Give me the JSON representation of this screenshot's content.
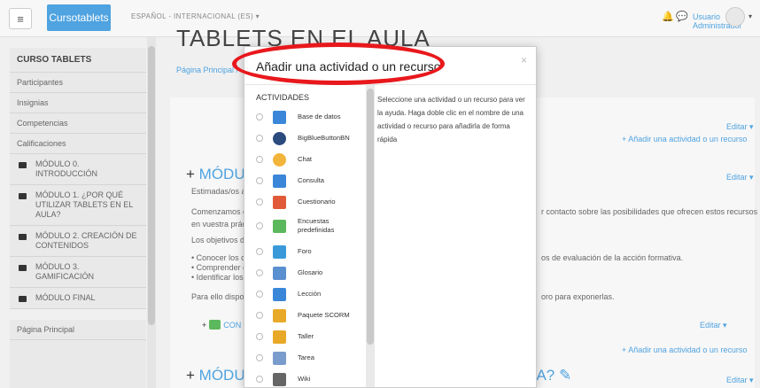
{
  "topbar": {
    "brand": "Cursotablets",
    "language": "ESPAÑOL - INTERNACIONAL (ES) ▾",
    "user_name": "Usuario Administrador",
    "menu_glyph": "≡",
    "bell_glyph": "🔔",
    "chat_glyph": "💬",
    "caret": "▾"
  },
  "left_nav": {
    "heading": "CURSO TABLETS",
    "items": [
      "Participantes",
      "Insignias",
      "Competencias",
      "Calificaciones"
    ],
    "modules": [
      "MÓDULO 0. INTRODUCCIÓN",
      "MÓDULO 1. ¿POR QUÉ UTILIZAR TABLETS EN EL AULA?",
      "MÓDULO 2. CREACIÓN DE CONTENIDOS",
      "MÓDULO 3. GAMIFICACIÓN",
      "MÓDULO FINAL"
    ],
    "footer_item": "Página Principal"
  },
  "page": {
    "title": "TABLETS EN EL AULA",
    "breadcrumb": "Página Principal /",
    "edit_label": "Editar ▾",
    "add_activity": "+ Añadir una actividad o un recurso",
    "module_heading": "MÓDUL",
    "module_heading2": "MÓDUL",
    "module_heading2_end": "LA? ✎",
    "lines_left": [
      "Estimadas/os al",
      "Comenzamos e",
      "en vuestra práct",
      "Los objetivos de",
      "• Conocer los c",
      "• Comprender c",
      "• Identificar los",
      "Para ello dispon"
    ],
    "lines_right": [
      "r contacto sobre las posibilidades que ofrecen estos recursos",
      "os de evaluación de la acción formativa.",
      "oro para exponerlas."
    ],
    "con_link": "CON",
    "plus_sign": "+"
  },
  "modal": {
    "title": "Añadir una actividad o un recurso",
    "close": "×",
    "list_header": "ACTIVIDADES",
    "help_text": "Seleccione una actividad o un recurso para ver la ayuda. Haga doble clic en el nombre de una actividad o recurso para añadirla de forma rápida",
    "activities": [
      {
        "label": "Base de datos",
        "icon": "database-icon",
        "color": "#3a87d9"
      },
      {
        "label": "BigBlueButtonBN",
        "icon": "bigbluebutton-icon",
        "color": "#2b4a7e"
      },
      {
        "label": "Chat",
        "icon": "chat-icon",
        "color": "#f2b43a"
      },
      {
        "label": "Consulta",
        "icon": "question-icon",
        "color": "#3a87d9"
      },
      {
        "label": "Cuestionario",
        "icon": "checkmark-icon",
        "color": "#e05a3a"
      },
      {
        "label": "Encuestas predefinidas",
        "icon": "bar-chart-icon",
        "color": "#5cb85c"
      },
      {
        "label": "Foro",
        "icon": "forum-icon",
        "color": "#3a9ad9"
      },
      {
        "label": "Glosario",
        "icon": "glossary-icon",
        "color": "#5a8fd0"
      },
      {
        "label": "Lección",
        "icon": "lesson-icon",
        "color": "#3a87d9"
      },
      {
        "label": "Paquete SCORM",
        "icon": "scorm-icon",
        "color": "#e8a828"
      },
      {
        "label": "Taller",
        "icon": "workshop-icon",
        "color": "#e8a828"
      },
      {
        "label": "Tarea",
        "icon": "assignment-icon",
        "color": "#7a9ccc"
      },
      {
        "label": "Wiki",
        "icon": "wiki-icon",
        "color": "#666666"
      }
    ]
  },
  "highlight_color": "#e8181c",
  "accent_color": "#4fa3e0"
}
